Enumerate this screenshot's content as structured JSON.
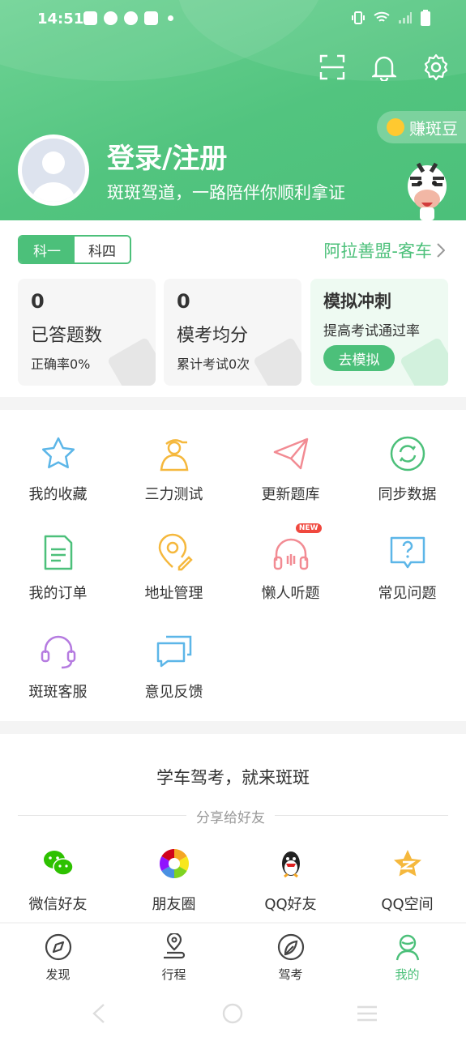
{
  "status_bar": {
    "time": "14:51"
  },
  "header": {
    "login_text": "登录/注册",
    "slogan": "斑斑驾道，一路陪伴你顺利拿证",
    "earn_beans": "赚斑豆"
  },
  "subject_tabs": [
    {
      "label": "科一",
      "active": true
    },
    {
      "label": "科四",
      "active": false
    }
  ],
  "region": "阿拉善盟-客车",
  "stats": [
    {
      "value": "0",
      "label": "已答题数",
      "sub": "正确率0%"
    },
    {
      "value": "0",
      "label": "模考均分",
      "sub": "累计考试0次"
    }
  ],
  "mock": {
    "title": "模拟冲刺",
    "desc": "提高考试通过率",
    "button": "去模拟"
  },
  "features": [
    {
      "label": "我的收藏",
      "icon": "star-icon"
    },
    {
      "label": "三力测试",
      "icon": "person-cap-icon"
    },
    {
      "label": "更新题库",
      "icon": "paper-plane-icon"
    },
    {
      "label": "同步数据",
      "icon": "sync-icon"
    },
    {
      "label": "我的订单",
      "icon": "document-icon"
    },
    {
      "label": "地址管理",
      "icon": "location-icon"
    },
    {
      "label": "懒人听题",
      "icon": "headphones-icon",
      "badge": "NEW"
    },
    {
      "label": "常见问题",
      "icon": "question-icon"
    },
    {
      "label": "斑斑客服",
      "icon": "headset-icon"
    },
    {
      "label": "意见反馈",
      "icon": "chat-icon"
    }
  ],
  "share": {
    "title": "学车驾考，就来斑斑",
    "subtitle": "分享给好友",
    "items": [
      {
        "label": "微信好友",
        "icon": "wechat-icon"
      },
      {
        "label": "朋友圈",
        "icon": "moments-icon"
      },
      {
        "label": "QQ好友",
        "icon": "qq-icon"
      },
      {
        "label": "QQ空间",
        "icon": "qzone-icon"
      }
    ]
  },
  "bottom_nav": [
    {
      "label": "发现",
      "icon": "compass-icon",
      "active": false
    },
    {
      "label": "行程",
      "icon": "route-icon",
      "active": false
    },
    {
      "label": "驾考",
      "icon": "leaf-icon",
      "active": false
    },
    {
      "label": "我的",
      "icon": "profile-icon",
      "active": true
    }
  ],
  "colors": {
    "brand_green": "#4cc07a",
    "badge_red": "#f0483e"
  }
}
